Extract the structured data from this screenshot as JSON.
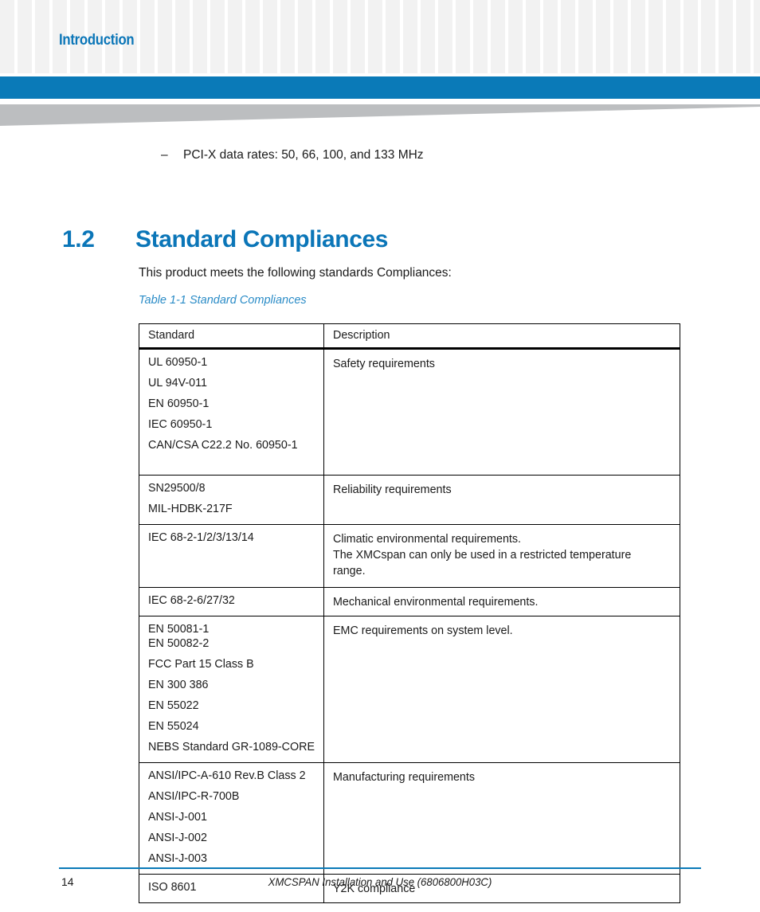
{
  "header": {
    "running_head": "Introduction",
    "accent_blue": "#0a7ab8",
    "wedge_gray": "#bcbec0"
  },
  "body": {
    "bullet_dash": "–",
    "bullet_text": "PCI-X data rates: 50, 66, 100, and 133 MHz",
    "section_number": "1.2",
    "section_title": "Standard Compliances",
    "lead_paragraph": "This product meets the following standards Compliances:",
    "table_caption": "Table 1-1 Standard Compliances"
  },
  "table": {
    "columns": [
      "Standard",
      "Description"
    ],
    "rows": [
      {
        "standards": [
          "UL 60950-1",
          "UL 94V-011",
          "EN 60950-1",
          "IEC 60950-1",
          "CAN/CSA C22.2 No. 60950-1"
        ],
        "description": [
          "Safety requirements"
        ],
        "size": "lg"
      },
      {
        "standards": [
          "SN29500/8",
          "MIL-HDBK-217F"
        ],
        "description": [
          "Reliability requirements"
        ],
        "size": "sm"
      },
      {
        "standards": [
          "IEC 68-2-1/2/3/13/14"
        ],
        "description": [
          "Climatic environmental requirements.",
          "The XMCspan can only be used in a restricted temperature",
          "range."
        ],
        "size": "sm"
      },
      {
        "standards": [
          "IEC 68-2-6/27/32"
        ],
        "description": [
          "Mechanical environmental requirements."
        ],
        "size": "xs"
      },
      {
        "standards": [
          "EN 50081-1",
          "EN 50082-2",
          "FCC Part 15 Class B",
          "EN 300 386",
          "EN 55022",
          "EN 55024",
          "NEBS Standard GR-1089-CORE"
        ],
        "description": [
          "EMC requirements on system level."
        ],
        "size": "sm",
        "tight_first": true
      },
      {
        "standards": [
          "ANSI/IPC-A-610 Rev.B Class 2",
          "ANSI/IPC-R-700B",
          "ANSI-J-001",
          "ANSI-J-002",
          "ANSI-J-003"
        ],
        "description": [
          "Manufacturing requirements"
        ],
        "size": "sm"
      },
      {
        "standards": [
          "ISO 8601"
        ],
        "description": [
          "Y2K compliance"
        ],
        "size": "xs"
      }
    ]
  },
  "footer": {
    "page_number": "14",
    "document_title": "XMCSPAN Installation and Use (6806800H03C)"
  }
}
